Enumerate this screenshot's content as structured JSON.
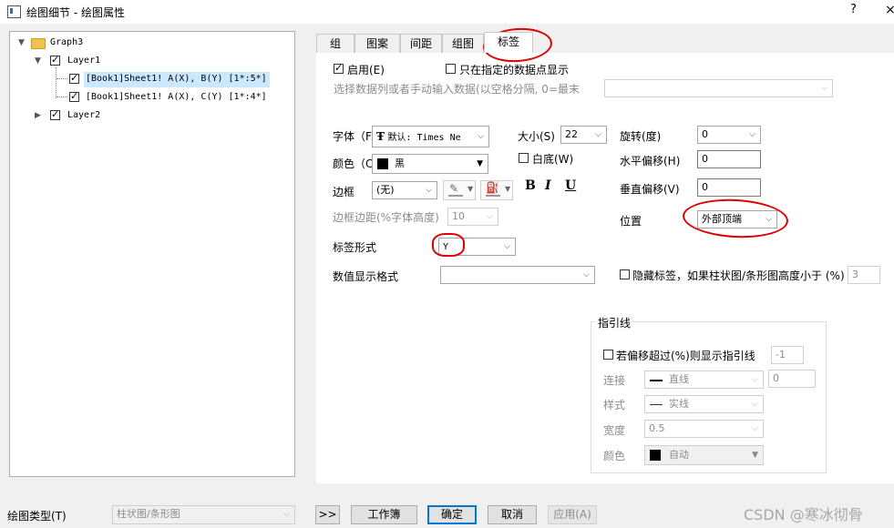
{
  "window": {
    "title": "绘图细节 - 绘图属性",
    "help_label": "?",
    "close_label": "×"
  },
  "tree": {
    "graph": "Graph3",
    "layer1": "Layer1",
    "item1": "[Book1]Sheet1! A(X), B(Y) [1*:5*]",
    "item2": "[Book1]Sheet1! A(X), C(Y) [1*:4*]",
    "layer2": "Layer2"
  },
  "tabs": [
    "组",
    "图案",
    "间距",
    "组图",
    "标签"
  ],
  "labels_tab": {
    "enable_label": "启用(E)",
    "only_specified_label": "只在指定的数据点显示",
    "select_data_hint": "选择数据列或者手动输入数据(以空格分隔, 0=最末",
    "font_label": "字体（F",
    "font_value": "默认: Times Ne",
    "size_label": "大小(S)",
    "size_value": "22",
    "rotate_label": "旋转(度)",
    "rotate_value": "0",
    "color_label": "颜色（C",
    "color_value": "黑",
    "white_bg_label": "白底(W)",
    "h_offset_label": "水平偏移(H)",
    "h_offset_value": "0",
    "border_label": "边框",
    "border_value": "(无)",
    "bold_label": "B",
    "italic_label": "I",
    "underline_label": "U",
    "v_offset_label": "垂直偏移(V)",
    "v_offset_value": "0",
    "border_margin_label": "边框边距(%字体高度)",
    "border_margin_value": "10",
    "position_label": "位置",
    "position_value": "外部顶端",
    "label_form_label": "标签形式",
    "label_form_value": "Y",
    "number_format_label": "数值显示格式",
    "number_format_value": "",
    "hide_label_text": "隐藏标签，如果柱状图/条形图高度小于 (%)",
    "hide_label_value": "3"
  },
  "leader_line": {
    "title": "指引线",
    "show_if_label": "若偏移超过(%)则显示指引线",
    "show_if_value": "-1",
    "connect_label": "连接",
    "connect_value": "直线",
    "connect_extra": "0",
    "style_label": "样式",
    "style_value": "实线",
    "width_label": "宽度",
    "width_value": "0.5",
    "color_label": "颜色",
    "color_value": "自动"
  },
  "footer": {
    "plot_type_label": "绘图类型(T)",
    "plot_type_value": "柱状图/条形图",
    "expand_label": ">>",
    "workbook_label": "工作簿",
    "ok_label": "确定",
    "cancel_label": "取消",
    "apply_label": "应用(A)"
  },
  "watermark": "CSDN @寒冰彻骨",
  "colors": {
    "accent": "#0078d7",
    "selection": "#cce8ff",
    "annotation": "#e00000"
  }
}
